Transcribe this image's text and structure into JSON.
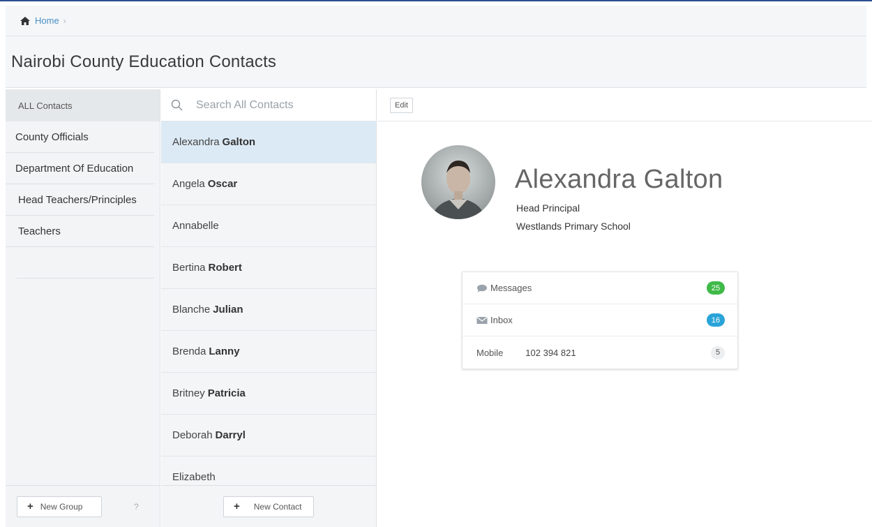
{
  "breadcrumb": {
    "home_label": "Home",
    "separator": "›"
  },
  "page": {
    "title": "Nairobi County Education Contacts"
  },
  "groups": {
    "all_label": "ALL Contacts",
    "items": [
      {
        "label": "County Officials"
      },
      {
        "label": "Department Of Education"
      },
      {
        "label": "Head Teachers/Principles"
      },
      {
        "label": "Teachers"
      }
    ],
    "new_group_label": "New Group",
    "help_label": "?"
  },
  "contacts": {
    "search_placeholder": "Search All Contacts",
    "list": [
      {
        "first": "Alexandra",
        "last": "Galton"
      },
      {
        "first": "Angela",
        "last": "Oscar"
      },
      {
        "first": "Annabelle",
        "last": ""
      },
      {
        "first": "Bertina",
        "last": "Robert"
      },
      {
        "first": "Blanche",
        "last": "Julian"
      },
      {
        "first": "Brenda",
        "last": "Lanny"
      },
      {
        "first": "Britney",
        "last": "Patricia"
      },
      {
        "first": "Deborah",
        "last": "Darryl"
      },
      {
        "first": "Elizabeth",
        "last": ""
      }
    ],
    "new_contact_label": "New Contact"
  },
  "detail": {
    "edit_label": "Edit",
    "name": "Alexandra Galton",
    "role": "Head Principal",
    "school": "Westlands Primary School",
    "stats": {
      "messages_label": "Messages",
      "messages_count": "25",
      "inbox_label": "Inbox",
      "inbox_count": "16",
      "mobile_label": "Mobile",
      "mobile_number": "102 394 821",
      "mobile_count": "5"
    }
  },
  "colors": {
    "link": "#4a8ec2",
    "active_row": "#dceaf5",
    "badge_green": "#3fba48",
    "badge_blue": "#2aa4d8"
  }
}
